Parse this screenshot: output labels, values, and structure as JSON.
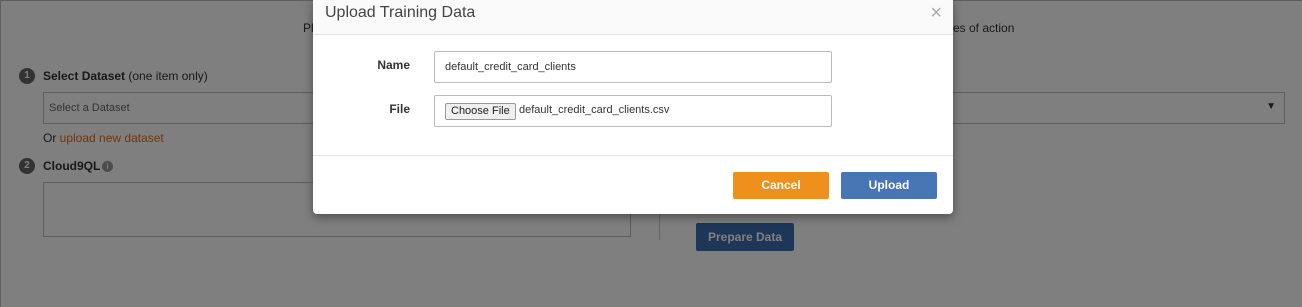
{
  "background": {
    "intro_left": "Pl",
    "intro_right": "es of action",
    "step1": {
      "number": "1",
      "label": "Select Dataset",
      "hint": " (one item only)"
    },
    "dataset_select": {
      "placeholder": "Select a Dataset",
      "arrow": "▼"
    },
    "upload_line": {
      "prefix": "Or ",
      "link": "upload new dataset"
    },
    "step2": {
      "number": "2",
      "label": "Cloud9QL",
      "info_glyph": "i"
    },
    "prepare_button": "Prepare Data"
  },
  "modal": {
    "title": "Upload Training Data",
    "close_glyph": "×",
    "name_label": "Name",
    "name_value": "default_credit_card_clients",
    "file_label": "File",
    "choose_file_label": "Choose File",
    "file_name": "default_credit_card_clients.csv",
    "cancel_label": "Cancel",
    "upload_label": "Upload"
  },
  "colors": {
    "accent_orange": "#f0901c",
    "accent_blue": "#4775b5",
    "link_orange": "#e06b1c"
  }
}
